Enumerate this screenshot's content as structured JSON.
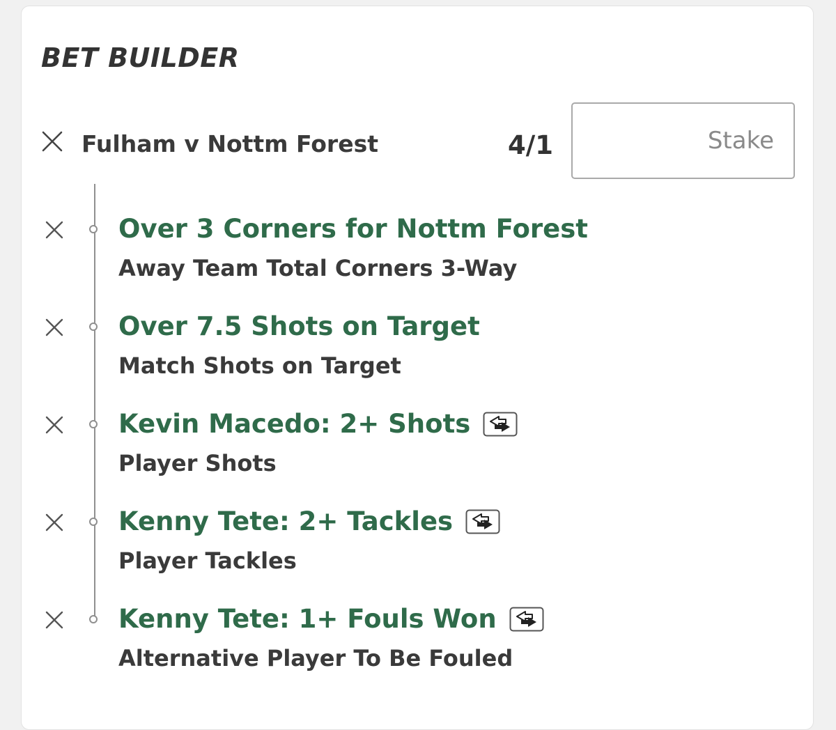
{
  "header": {
    "title": "BET BUILDER"
  },
  "match": {
    "name": "Fulham v Nottm Forest",
    "odds": "4/1",
    "stake_placeholder": "Stake"
  },
  "selections": [
    {
      "title": "Over 3 Corners for Nottm Forest",
      "market": "Away Team Total Corners 3-Way",
      "swap_icon": false
    },
    {
      "title": "Over 7.5 Shots on Target",
      "market": "Match Shots on Target",
      "swap_icon": false
    },
    {
      "title": "Kevin Macedo: 2+ Shots",
      "market": "Player Shots",
      "swap_icon": true
    },
    {
      "title": "Kenny Tete: 2+ Tackles",
      "market": "Player Tackles",
      "swap_icon": true
    },
    {
      "title": "Kenny Tete: 1+ Fouls Won",
      "market": "Alternative Player To Be Fouled",
      "swap_icon": true
    }
  ],
  "icons": {
    "remove": "close-icon",
    "swap": "swap-player-icon"
  },
  "colors": {
    "selection_green": "#2f6b4a",
    "text_dark": "#333333",
    "timeline_gray": "#8f8f8f"
  }
}
